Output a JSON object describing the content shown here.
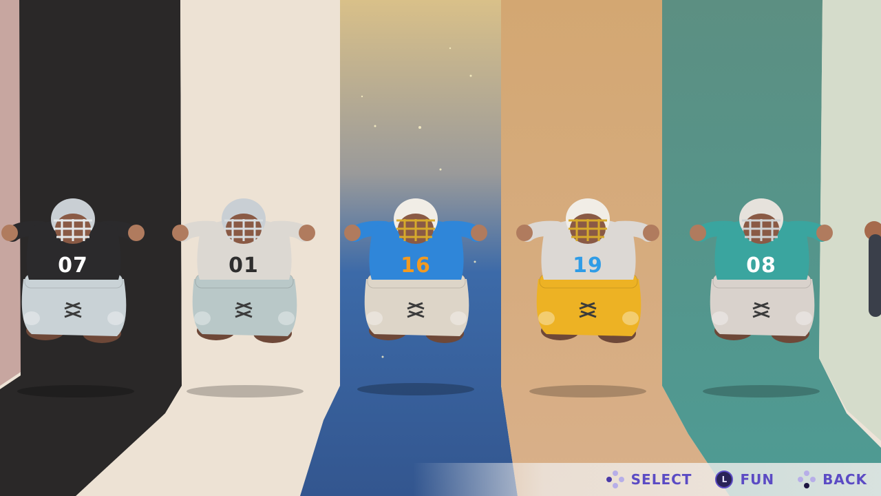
{
  "players": [
    {
      "number": "07",
      "jersey": "#2b2a2c",
      "number_color": "#ffffff",
      "pants": "#c9d2d6",
      "helmet": "#c9cfd4",
      "facemask": "#e4e8ea",
      "banner": "#2a2828"
    },
    {
      "number": "01",
      "jersey": "#dcd8d2",
      "number_color": "#2e2e2e",
      "pants": "#b9c8c8",
      "helmet": "#c9cfd4",
      "facemask": "#d8dde0",
      "banner": "#efe4d6"
    },
    {
      "number": "16",
      "jersey": "#2f86d9",
      "number_color": "#f29a21",
      "pants": "#ddd5c8",
      "helmet": "#f1ede6",
      "facemask": "#d6aa2c",
      "banner": "#33568f"
    },
    {
      "number": "19",
      "jersey": "#dcd8d4",
      "number_color": "#2f9ce6",
      "pants": "#edb224",
      "helmet": "#f1ede6",
      "facemask": "#d6aa2c",
      "banner": "#d4a674"
    },
    {
      "number": "08",
      "jersey": "#3aa59f",
      "number_color": "#ffffff",
      "pants": "#d9d2cc",
      "helmet": "#e6e2dc",
      "facemask": "#cfd3d4",
      "banner": "#4f9a92"
    }
  ],
  "controls": {
    "select_label": "SELECT",
    "fun_label": "FUN",
    "fun_stick": "L",
    "back_label": "BACK"
  }
}
